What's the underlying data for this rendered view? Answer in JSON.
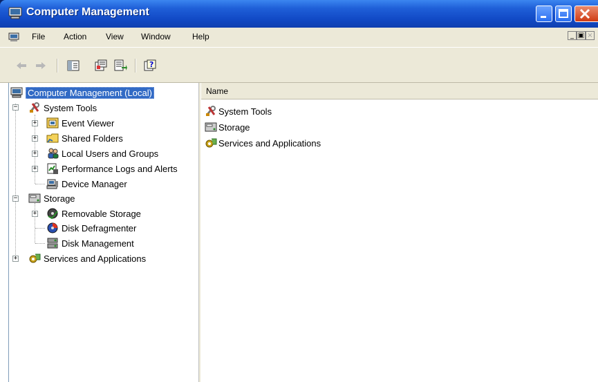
{
  "window": {
    "title": "Computer Management"
  },
  "menubar": {
    "items": [
      "File",
      "Action",
      "View",
      "Window",
      "Help"
    ]
  },
  "toolbar": {
    "buttons": [
      "back-icon",
      "forward-icon",
      "show-hide-tree-icon",
      "properties-icon",
      "export-list-icon",
      "help-icon"
    ]
  },
  "tree": {
    "root": "Computer Management (Local)",
    "system_tools": {
      "label": "System Tools",
      "children": [
        "Event Viewer",
        "Shared Folders",
        "Local Users and Groups",
        "Performance Logs and Alerts",
        "Device Manager"
      ]
    },
    "storage": {
      "label": "Storage",
      "children": [
        "Removable Storage",
        "Disk Defragmenter",
        "Disk Management"
      ]
    },
    "services": {
      "label": "Services and Applications"
    }
  },
  "list": {
    "column": "Name",
    "items": [
      "System Tools",
      "Storage",
      "Services and Applications"
    ]
  },
  "colors": {
    "title_bar": "#1149c5",
    "selection": "#316ac5",
    "chrome": "#ece9d8"
  }
}
